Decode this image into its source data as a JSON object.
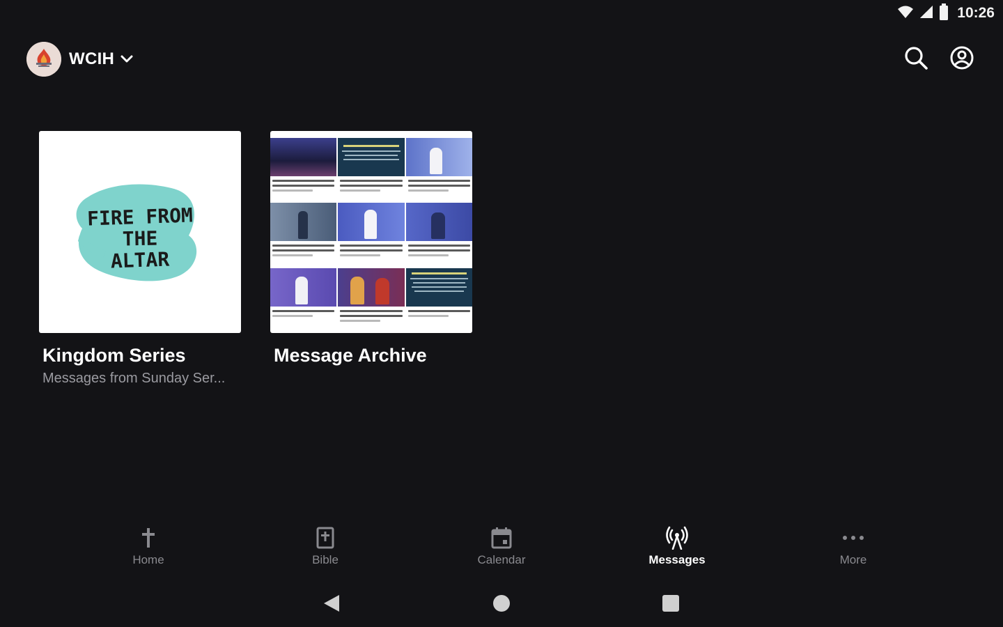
{
  "status_bar": {
    "time": "10:26",
    "icons": [
      "wifi-icon",
      "cell-signal-icon",
      "battery-icon"
    ]
  },
  "app_bar": {
    "org_name": "WCIH",
    "actions": [
      "search-icon",
      "account-icon"
    ]
  },
  "collections": [
    {
      "title": "Kingdom Series",
      "subtitle": "Messages from Sunday Ser...",
      "thumbnail_text": [
        "FIRE FROM",
        "THE",
        "ALTAR"
      ]
    },
    {
      "title": "Message Archive",
      "subtitle": ""
    }
  ],
  "bottom_nav": {
    "items": [
      {
        "label": "Home",
        "icon": "cross-icon",
        "active": false
      },
      {
        "label": "Bible",
        "icon": "bible-icon",
        "active": false
      },
      {
        "label": "Calendar",
        "icon": "calendar-icon",
        "active": false
      },
      {
        "label": "Messages",
        "icon": "broadcast-icon",
        "active": true
      },
      {
        "label": "More",
        "icon": "more-dots-icon",
        "active": false
      }
    ]
  },
  "system_nav": [
    "back-icon",
    "home-circle-icon",
    "recents-square-icon"
  ],
  "colors": {
    "background": "#131316",
    "text_primary": "#ffffff",
    "text_secondary": "#9b9ba1",
    "nav_inactive": "#8a8a8f",
    "brush_teal": "#7fd3cc"
  }
}
